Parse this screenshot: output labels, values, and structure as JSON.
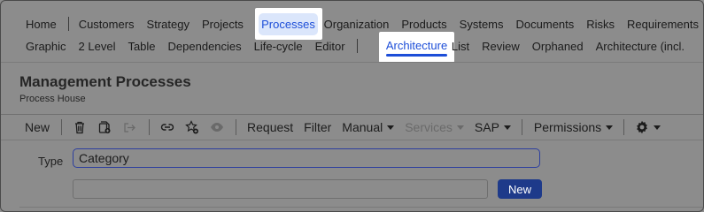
{
  "nav": {
    "primary": [
      "Home",
      "Customers",
      "Strategy",
      "Projects",
      "Processes",
      "Organization",
      "Products",
      "Systems",
      "Documents",
      "Risks",
      "Requirements"
    ],
    "secondary": [
      "Graphic",
      "2 Level",
      "Table",
      "Dependencies",
      "Life-cycle",
      "Editor",
      "Architecture",
      "List",
      "Review",
      "Orphaned",
      "Architecture (incl."
    ]
  },
  "page": {
    "title": "Management Processes",
    "subtitle": "Process House"
  },
  "toolbar": {
    "new_label": "New",
    "request_label": "Request",
    "filter_label": "Filter",
    "manual_label": "Manual",
    "services_label": "Services",
    "sap_label": "SAP",
    "permissions_label": "Permissions"
  },
  "form": {
    "type_label": "Type",
    "type_value": "Category",
    "add_button": "New"
  },
  "colors": {
    "accent": "#1d4ed8",
    "button": "#1e3a8a",
    "overlay": "#8c8c8c"
  }
}
